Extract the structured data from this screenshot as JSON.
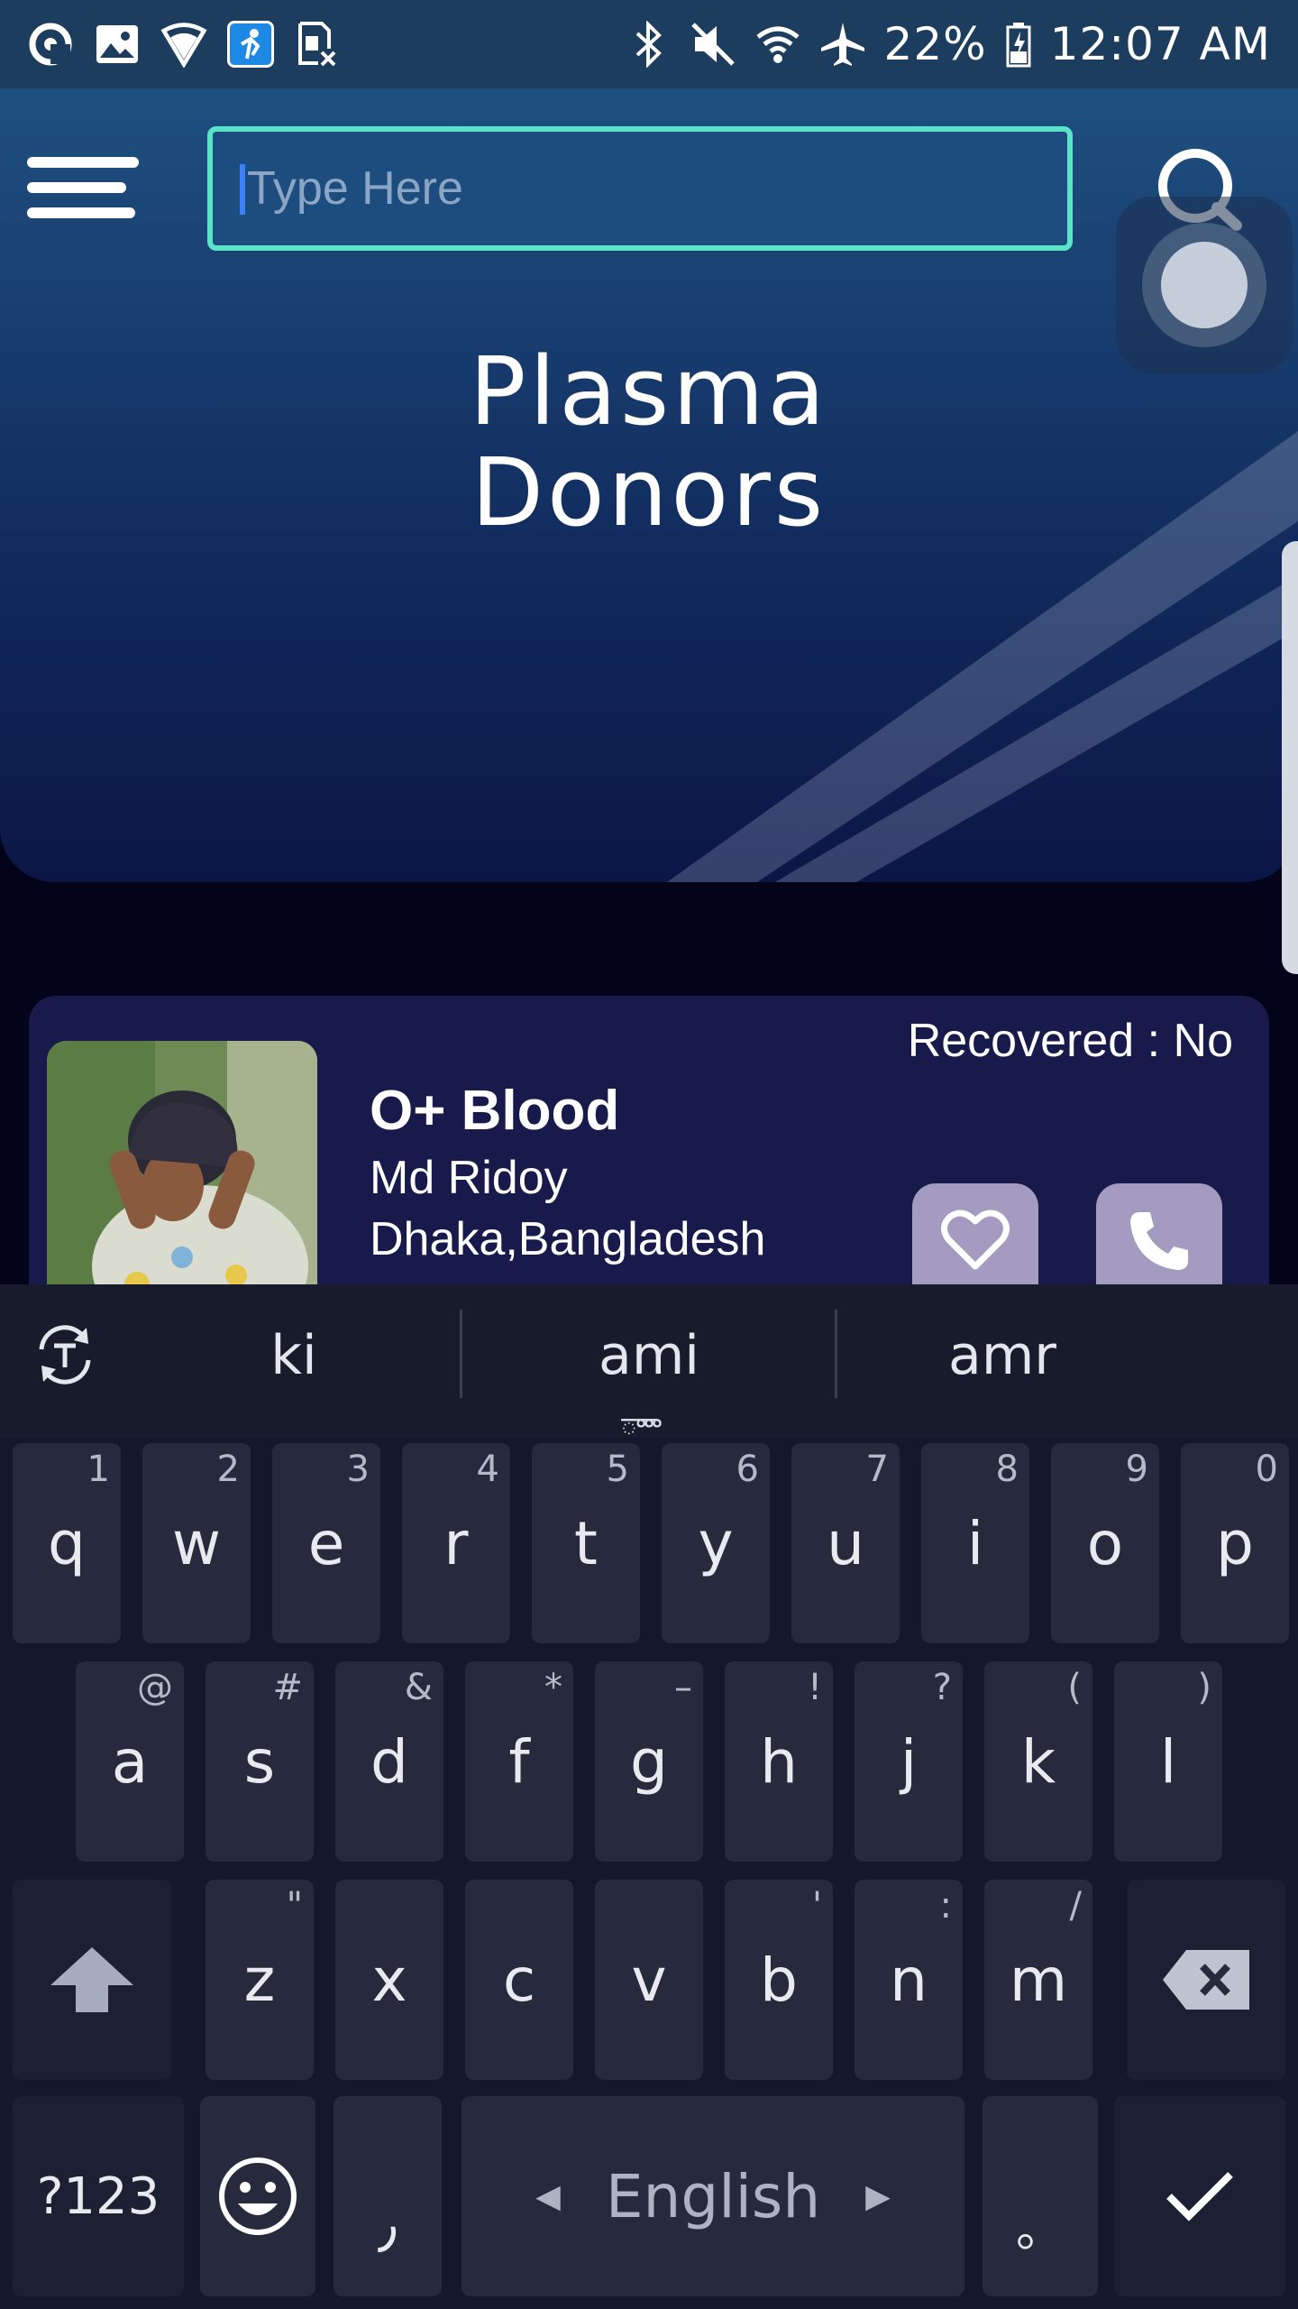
{
  "status_bar": {
    "battery": "22%",
    "time": "12:07 AM"
  },
  "search": {
    "placeholder": "Type Here"
  },
  "header": {
    "title_line1": "Plasma",
    "title_line2": "Donors"
  },
  "donor_card": {
    "recovered": "Recovered : No",
    "blood_group": "O+ Blood",
    "name": "Md Ridoy",
    "location": "Dhaka,Bangladesh"
  },
  "keyboard": {
    "suggestions": [
      "ki",
      "ami",
      "amr"
    ],
    "suggestion_dots": "ాాా",
    "row1": [
      {
        "key": "q",
        "hint": "1"
      },
      {
        "key": "w",
        "hint": "2"
      },
      {
        "key": "e",
        "hint": "3"
      },
      {
        "key": "r",
        "hint": "4"
      },
      {
        "key": "t",
        "hint": "5"
      },
      {
        "key": "y",
        "hint": "6"
      },
      {
        "key": "u",
        "hint": "7"
      },
      {
        "key": "i",
        "hint": "8"
      },
      {
        "key": "o",
        "hint": "9"
      },
      {
        "key": "p",
        "hint": "0"
      }
    ],
    "row2": [
      {
        "key": "a",
        "hint": "@"
      },
      {
        "key": "s",
        "hint": "#"
      },
      {
        "key": "d",
        "hint": "&"
      },
      {
        "key": "f",
        "hint": "*"
      },
      {
        "key": "g",
        "hint": "–"
      },
      {
        "key": "h",
        "hint": "!"
      },
      {
        "key": "j",
        "hint": "?"
      },
      {
        "key": "k",
        "hint": "("
      },
      {
        "key": "l",
        "hint": ")"
      }
    ],
    "row3": [
      {
        "key": "z",
        "hint": "\""
      },
      {
        "key": "x",
        "hint": ""
      },
      {
        "key": "c",
        "hint": ""
      },
      {
        "key": "v",
        "hint": ""
      },
      {
        "key": "b",
        "hint": "'"
      },
      {
        "key": "n",
        "hint": ":"
      },
      {
        "key": "m",
        "hint": "/"
      }
    ],
    "symbols_label": "?123",
    "comma": "٫",
    "space_label": "English",
    "period": "。"
  },
  "colors": {
    "search_border": "#5ae3c9",
    "header_top": "#1e5080",
    "header_bottom": "#0b1646",
    "card_bg": "#171a4a",
    "action_button": "#a39cc0"
  }
}
